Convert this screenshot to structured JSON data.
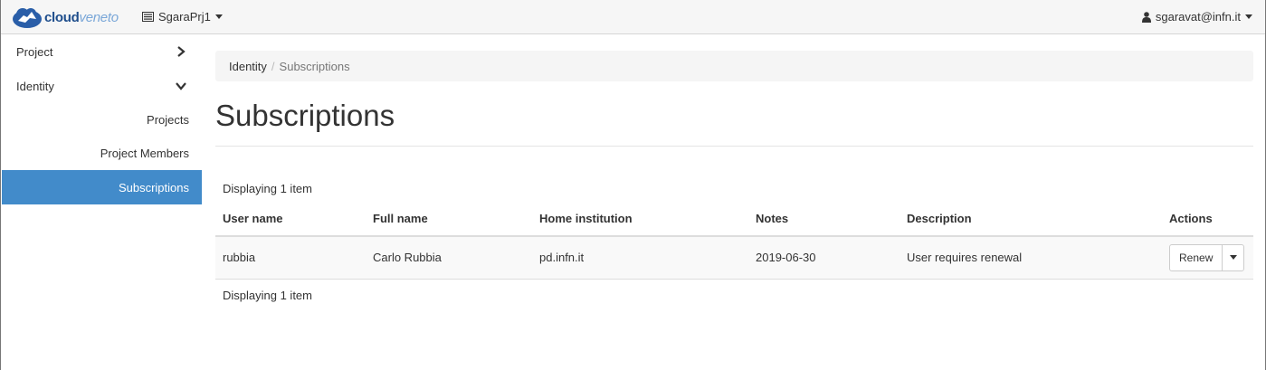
{
  "navbar": {
    "brand_cloud": "cloud",
    "brand_veneto": "veneto",
    "project": "SgaraPrj1",
    "user": "sgaravat@infn.it"
  },
  "sidebar": {
    "items": [
      {
        "label": "Project"
      },
      {
        "label": "Identity"
      }
    ],
    "sub_items": [
      {
        "label": "Projects"
      },
      {
        "label": "Project Members"
      },
      {
        "label": "Subscriptions"
      }
    ]
  },
  "breadcrumb": {
    "parent": "Identity",
    "sep": "/",
    "current": "Subscriptions"
  },
  "page": {
    "title": "Subscriptions",
    "count_top": "Displaying 1 item",
    "count_bottom": "Displaying 1 item"
  },
  "table": {
    "headers": [
      "User name",
      "Full name",
      "Home institution",
      "Notes",
      "Description",
      "Actions"
    ],
    "rows": [
      {
        "user_name": "rubbia",
        "full_name": "Carlo Rubbia",
        "home_institution": "pd.infn.it",
        "notes": "2019-06-30",
        "description": "User requires renewal",
        "action_label": "Renew"
      }
    ]
  },
  "colors": {
    "active_nav": "#428bca",
    "brand": "#1f4e8c"
  }
}
